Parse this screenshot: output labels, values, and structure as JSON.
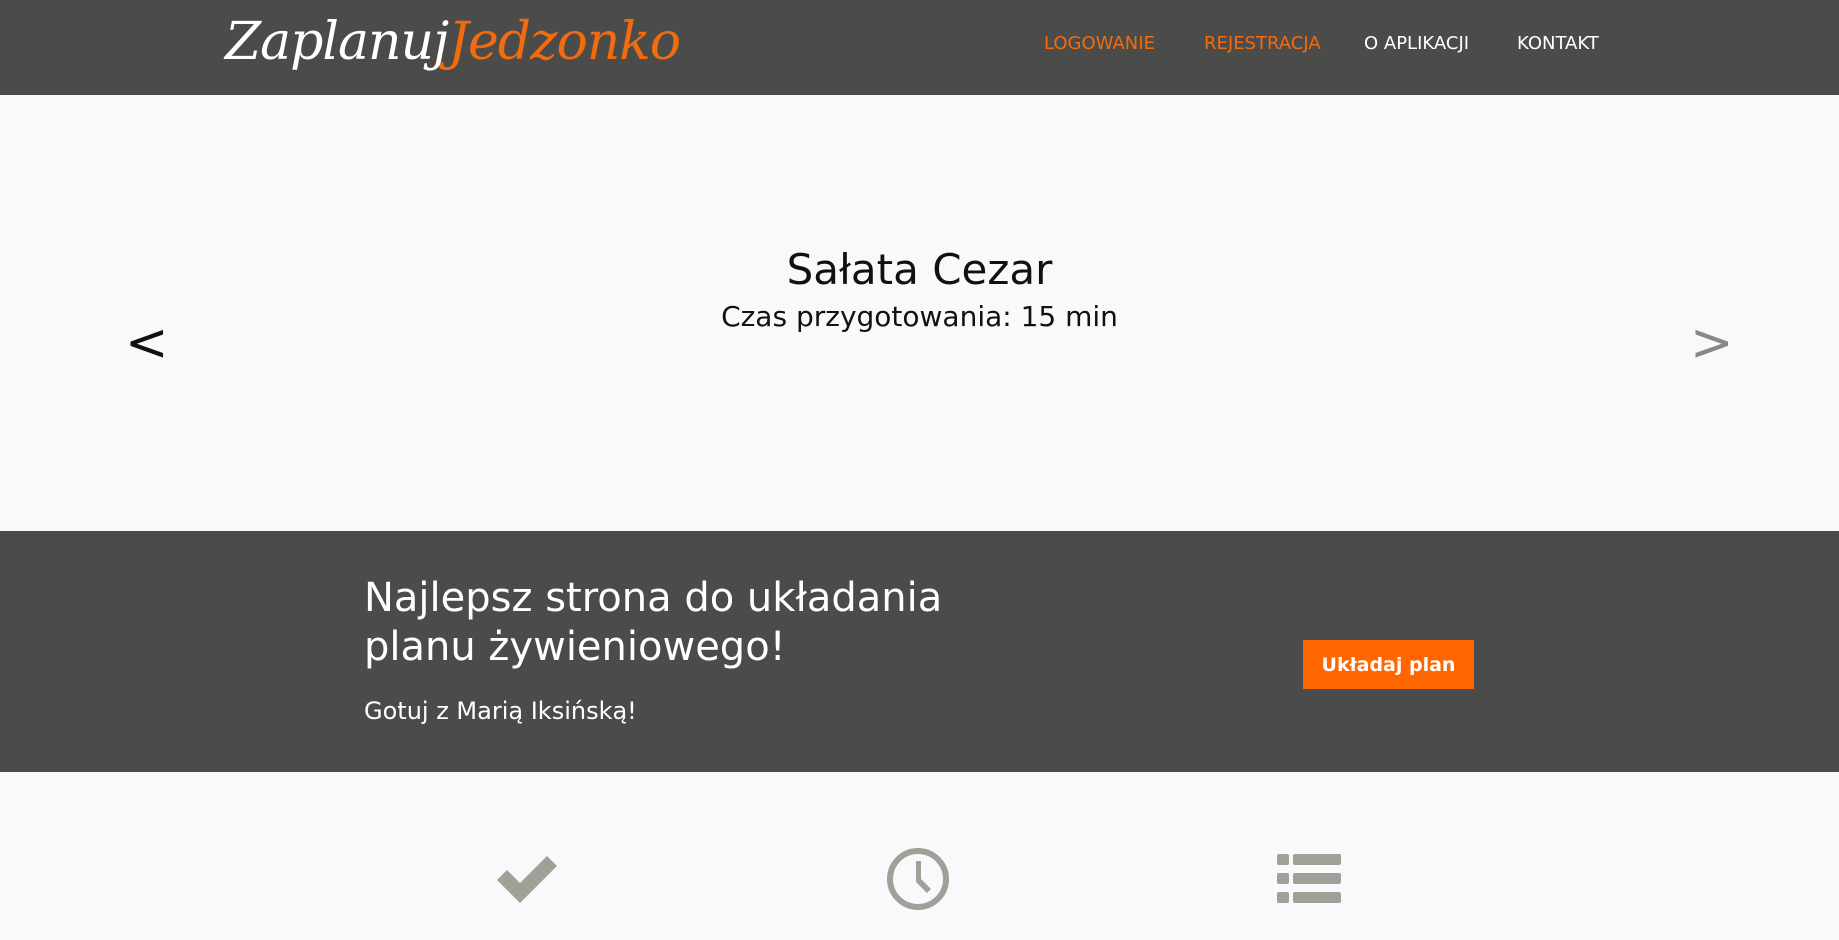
{
  "brand": {
    "part1": "Zaplanuj",
    "part2": "Jedzonko",
    "colors": {
      "accent": "#f26b0f",
      "nav_bg": "#4b4b4a",
      "button": "#ff6600",
      "icon": "#9fa199"
    }
  },
  "nav": {
    "items": [
      {
        "label": "LOGOWANIE",
        "accent": true
      },
      {
        "label": "REJESTRACJA",
        "accent": true
      },
      {
        "label": "O APLIKACJI",
        "accent": false
      },
      {
        "label": "KONTAKT",
        "accent": false
      }
    ]
  },
  "carousel": {
    "title": "Sałata Cezar",
    "subtitle": "Czas przygotowania: 15 min",
    "prev_label": "<",
    "next_label": ">"
  },
  "banner": {
    "heading": "Najlepsz strona do układania planu żywieniowego!",
    "subtext": "Gotuj z Marią Iksińską!",
    "button_label": "Układaj plan"
  },
  "features": {
    "icons": [
      "check-icon",
      "clock-icon",
      "list-icon"
    ]
  }
}
